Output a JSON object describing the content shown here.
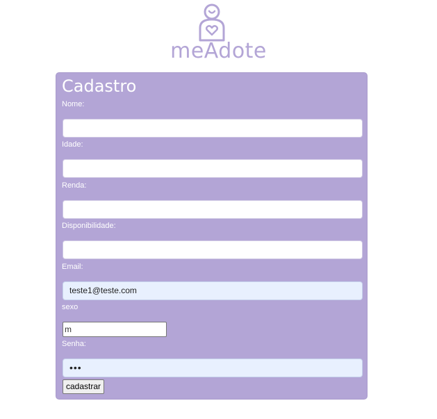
{
  "brand": {
    "name": "meAdote",
    "color": "#b3a5d6"
  },
  "form": {
    "title": "Cadastro",
    "fields": {
      "nome": {
        "label": "Nome:",
        "value": ""
      },
      "idade": {
        "label": "Idade:",
        "value": ""
      },
      "renda": {
        "label": "Renda:",
        "value": ""
      },
      "disponibilidade": {
        "label": "Disponibilidade:",
        "value": ""
      },
      "email": {
        "label": "Email:",
        "value": "teste1@teste.com"
      },
      "sexo": {
        "label": "sexo",
        "value": "m"
      },
      "senha": {
        "label": "Senha:",
        "value": "•••"
      }
    },
    "submit_label": "cadastrar"
  },
  "icons": {
    "logo": "mother-holding-heart-icon"
  }
}
